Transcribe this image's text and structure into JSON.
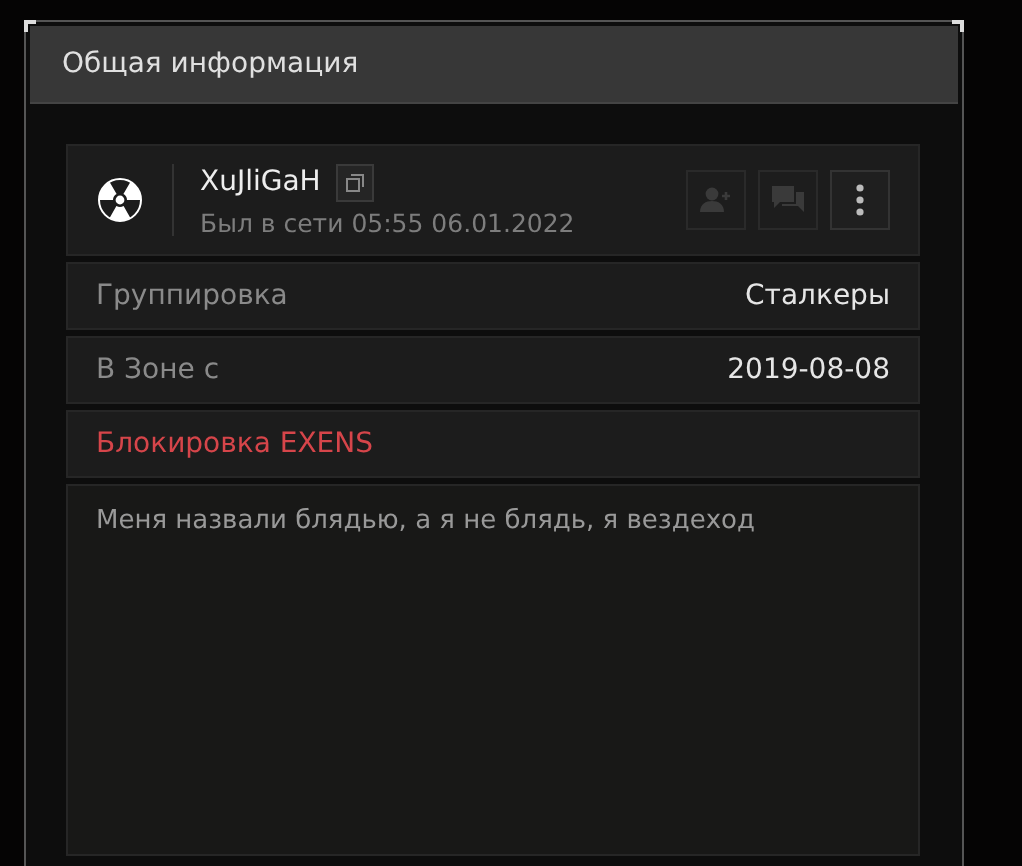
{
  "panel": {
    "title": "Общая информация"
  },
  "profile": {
    "name": "XuJliGaH",
    "last_seen": "Был в сети 05:55 06.01.2022",
    "actions": [
      {
        "kind": "add-friend",
        "disabled": true
      },
      {
        "kind": "message",
        "disabled": true
      },
      {
        "kind": "more",
        "disabled": false
      }
    ]
  },
  "fields": [
    {
      "label": "Группировка",
      "value": "Сталкеры"
    },
    {
      "label": "В Зоне с",
      "value": "2019-08-08"
    }
  ],
  "ban_notice": "Блокировка EXENS",
  "status_text": "Меня назвали блядью, а я не блядь, я вездеход"
}
